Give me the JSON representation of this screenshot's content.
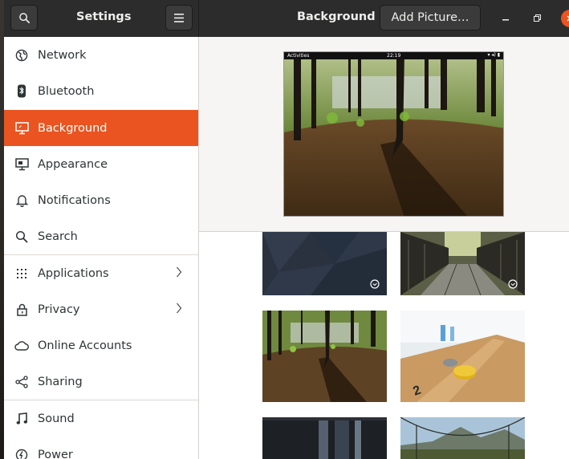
{
  "header": {
    "app_title": "Settings",
    "page_title": "Background",
    "add_picture_label": "Add Picture…",
    "search_icon": "search-icon",
    "menu_icon": "hamburger-menu-icon",
    "minimize_icon": "minimize-icon",
    "maximize_icon": "maximize-icon",
    "close_icon": "close-icon"
  },
  "sidebar": {
    "items": [
      {
        "label": "Network",
        "icon": "network-globe-icon"
      },
      {
        "label": "Bluetooth",
        "icon": "bluetooth-icon"
      },
      {
        "label": "Background",
        "icon": "display-icon",
        "active": true
      },
      {
        "label": "Appearance",
        "icon": "appearance-icon"
      },
      {
        "label": "Notifications",
        "icon": "bell-icon"
      },
      {
        "label": "Search",
        "icon": "search-icon"
      },
      {
        "label": "Applications",
        "icon": "apps-grid-icon",
        "has_submenu": true
      },
      {
        "label": "Privacy",
        "icon": "lock-icon",
        "has_submenu": true
      },
      {
        "label": "Online Accounts",
        "icon": "cloud-icon"
      },
      {
        "label": "Sharing",
        "icon": "share-icon"
      },
      {
        "label": "Sound",
        "icon": "music-note-icon"
      },
      {
        "label": "Power",
        "icon": "power-icon"
      }
    ]
  },
  "preview": {
    "topbar_activities": "Activities",
    "topbar_clock": "22:19"
  },
  "wallpapers": [
    {
      "name": "dark-geometric",
      "timed": true
    },
    {
      "name": "bridge-walkway",
      "timed": true
    },
    {
      "name": "forest-shadow",
      "timed": false
    },
    {
      "name": "shuffleboard-table",
      "timed": false
    },
    {
      "name": "dark-pillars",
      "timed": false
    },
    {
      "name": "suspension-bridge-mountains",
      "timed": false
    }
  ],
  "colors": {
    "accent": "#e95420",
    "header_bg": "#2c2c2c",
    "sidebar_bg": "#ffffff"
  }
}
